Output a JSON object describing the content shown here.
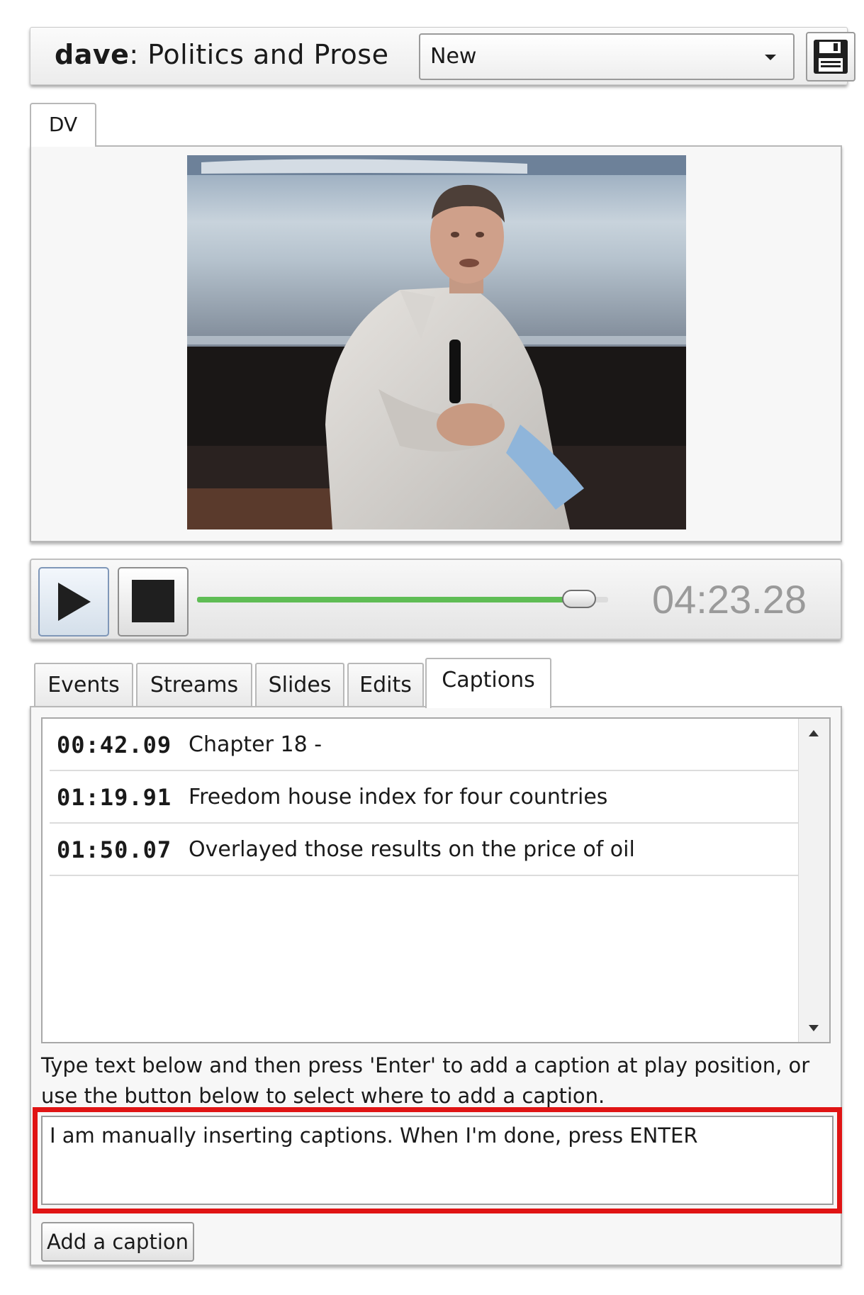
{
  "header": {
    "user": "dave",
    "separator": ":",
    "title": "Politics and Prose",
    "dropdown_value": "New",
    "save_icon": "floppy-disk-icon"
  },
  "video_tab": {
    "label": "DV"
  },
  "player": {
    "play_icon": "play-icon",
    "stop_icon": "stop-icon",
    "progress_fraction": 0.93,
    "time": "04:23.28",
    "progress_color": "#5fbd55"
  },
  "tabs": [
    {
      "label": "Events"
    },
    {
      "label": "Streams"
    },
    {
      "label": "Slides"
    },
    {
      "label": "Edits"
    },
    {
      "label": "Captions",
      "active": true
    }
  ],
  "captions": [
    {
      "time": "00:42.09",
      "text": "Chapter 18 -"
    },
    {
      "time": "01:19.91",
      "text": "Freedom house index for four countries"
    },
    {
      "time": "01:50.07",
      "text": "Overlayed those results on the price of oil"
    }
  ],
  "instructions": "Type text below and then press 'Enter' to add a caption at play position, or use the button below to select where to add a caption.",
  "caption_input": {
    "value": "I am manually inserting captions. When I'm done, press ENTER"
  },
  "add_caption_label": "Add a caption",
  "highlight_color": "#e01414"
}
